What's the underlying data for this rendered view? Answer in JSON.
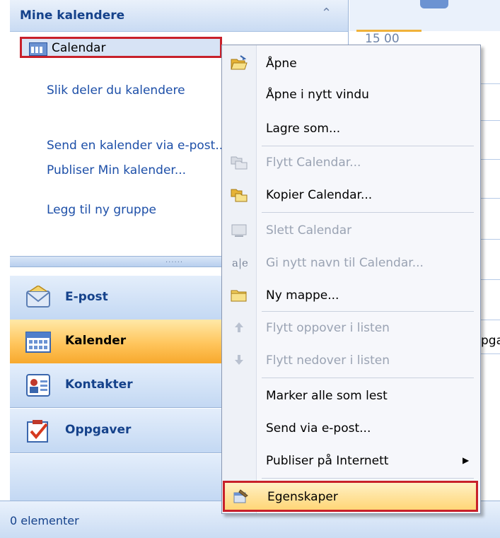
{
  "nav_pane": {
    "title": "Mine kalendere",
    "calendar_item": "Calendar",
    "links": [
      "Slik deler du kalendere",
      "Send en kalender via e-post...",
      "Publiser Min kalender...",
      "Legg til ny gruppe"
    ],
    "buttons": [
      {
        "label": "E-post",
        "icon": "mail-icon"
      },
      {
        "label": "Kalender",
        "icon": "calendar-icon",
        "selected": true
      },
      {
        "label": "Kontakter",
        "icon": "contacts-icon"
      },
      {
        "label": "Oppgaver",
        "icon": "tasks-icon"
      }
    ]
  },
  "calendar_view": {
    "time_label": "15 00",
    "partial_text": "pga"
  },
  "context_menu": {
    "items": [
      {
        "label": "Åpne",
        "enabled": true
      },
      {
        "label": "Åpne i nytt vindu",
        "enabled": true
      },
      {
        "label": "Lagre som...",
        "enabled": true
      },
      {
        "label": "Flytt Calendar...",
        "enabled": false
      },
      {
        "label": "Kopier Calendar...",
        "enabled": true
      },
      {
        "label": "Slett Calendar",
        "enabled": false
      },
      {
        "label": "Gi nytt navn til Calendar...",
        "enabled": false
      },
      {
        "label": "Ny mappe...",
        "enabled": true
      },
      {
        "label": "Flytt oppover i listen",
        "enabled": false
      },
      {
        "label": "Flytt nedover i listen",
        "enabled": false
      },
      {
        "label": "Marker alle som lest",
        "enabled": true
      },
      {
        "label": "Send via e-post...",
        "enabled": true
      },
      {
        "label": "Publiser på Internett",
        "enabled": true,
        "submenu": true
      },
      {
        "label": "Egenskaper",
        "enabled": true,
        "highlighted": true
      }
    ]
  },
  "status_bar": {
    "text": "0 elementer"
  },
  "colors": {
    "highlight_border": "#c8202a",
    "selected_button": "#ffc55c",
    "link": "#1d4fa8",
    "title": "#15428b"
  }
}
